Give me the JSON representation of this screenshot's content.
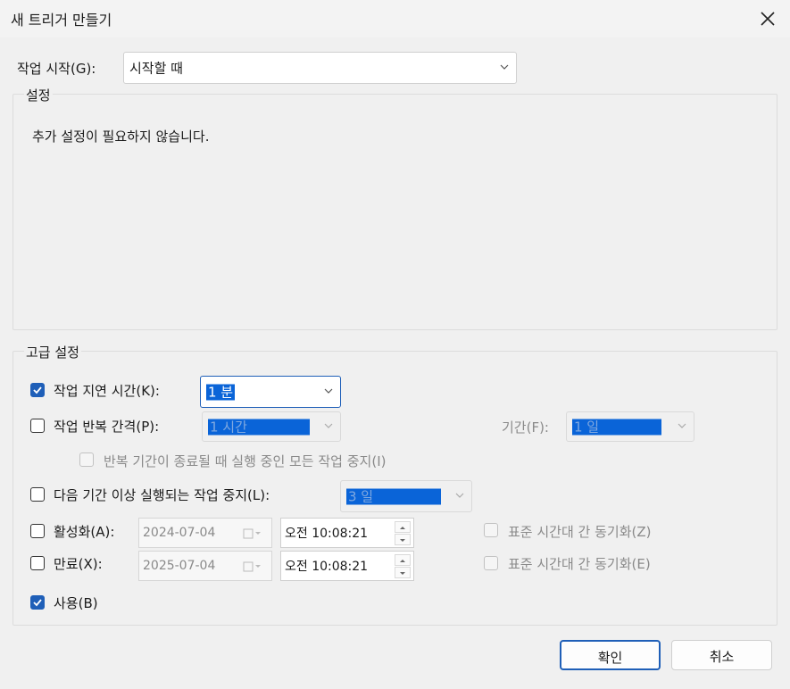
{
  "window": {
    "title": "새 트리거 만들기"
  },
  "start": {
    "label": "작업 시작(G):",
    "value": "시작할 때"
  },
  "settings": {
    "legend": "설정",
    "message": "추가 설정이 필요하지 않습니다."
  },
  "advanced": {
    "legend": "고급 설정",
    "delay": {
      "label": "작업 지연 시간(K):",
      "value": "1 분",
      "checked": true
    },
    "repeat": {
      "label": "작업 반복 간격(P):",
      "value": "1 시간",
      "duration_label": "기간(F):",
      "duration_value": "1 일",
      "checked": false
    },
    "stop_running": {
      "label": "반복 기간이 종료될 때 실행 중인 모든 작업 중지(I)"
    },
    "stop_longer": {
      "label": "다음 기간 이상 실행되는 작업 중지(L):",
      "value": "3 일",
      "checked": false
    },
    "activate": {
      "label": "활성화(A):",
      "date": "2024-07-04",
      "time": "오전 10:08:21",
      "sync_label": "표준 시간대 간 동기화(Z)",
      "checked": false
    },
    "expire": {
      "label": "만료(X):",
      "date": "2025-07-04",
      "time": "오전 10:08:21",
      "sync_label": "표준 시간대 간 동기화(E)",
      "checked": false
    },
    "enabled": {
      "label": "사용(B)",
      "checked": true
    }
  },
  "buttons": {
    "ok": "확인",
    "cancel": "취소"
  },
  "colors": {
    "accent": "#1f5fb8",
    "selection": "#0a64d8",
    "background": "#f0f0f0"
  }
}
